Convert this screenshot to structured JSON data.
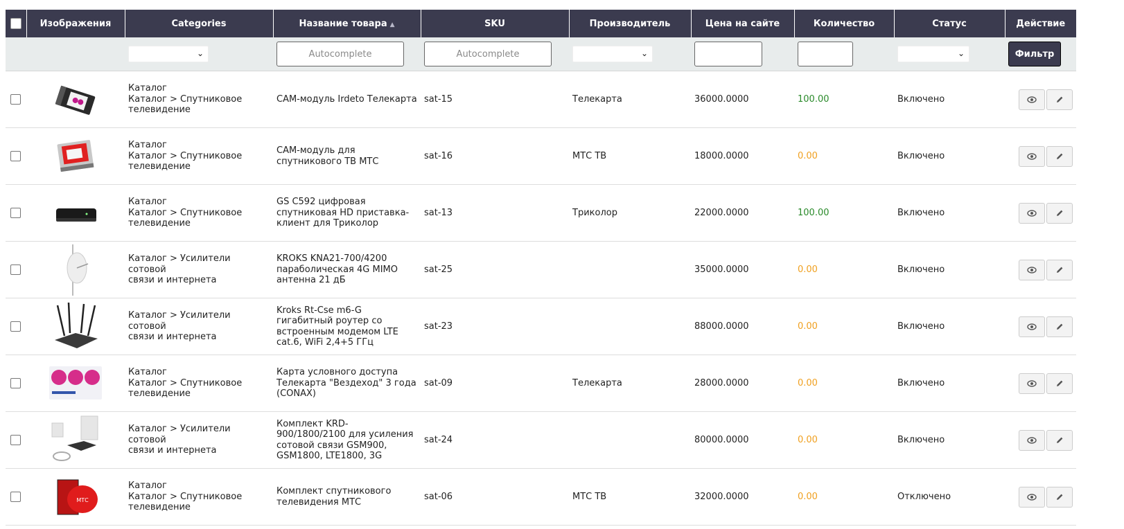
{
  "columns": {
    "images": "Изображения",
    "categories": "Categories",
    "name": "Название товара",
    "sku": "SKU",
    "manufacturer": "Производитель",
    "price": "Цена на сайте",
    "quantity": "Количество",
    "status": "Статус",
    "action": "Действие"
  },
  "filters": {
    "name_placeholder": "Autocomplete",
    "sku_placeholder": "Autocomplete",
    "button": "Фильтр"
  },
  "colors": {
    "header_bg": "#3b3b4f",
    "qty_positive": "#2a8a2a",
    "qty_zero": "#f0a020"
  },
  "rows": [
    {
      "image": "cam-module-irdeto-icon",
      "cat1": "Каталог",
      "cat2": "Каталог > Спутниковое",
      "cat3": "телевидение",
      "name": "CAM-модуль Irdeto Телекарта",
      "sku": "sat-15",
      "manufacturer": "Телекарта",
      "price": "36000.0000",
      "quantity": "100.00",
      "status": "Включено"
    },
    {
      "image": "cam-module-mts-icon",
      "cat1": "Каталог",
      "cat2": "Каталог > Спутниковое",
      "cat3": "телевидение",
      "name": "CAM-модуль для спутникового ТВ МТС",
      "sku": "sat-16",
      "manufacturer": "МТС ТВ",
      "price": "18000.0000",
      "quantity": "0.00",
      "status": "Включено"
    },
    {
      "image": "set-top-box-icon",
      "cat1": "Каталог",
      "cat2": "Каталог > Спутниковое",
      "cat3": "телевидение",
      "name": "GS C592 цифровая спутниковая HD приставка-клиент для Триколор",
      "sku": "sat-13",
      "manufacturer": "Триколор",
      "price": "22000.0000",
      "quantity": "100.00",
      "status": "Включено"
    },
    {
      "image": "antenna-icon",
      "cat1": "",
      "cat2": "Каталог > Усилители сотовой",
      "cat3": "связи и интернета",
      "name": "KROKS KNA21-700/4200 параболическая 4G MIMO антенна 21 дБ",
      "sku": "sat-25",
      "manufacturer": "",
      "price": "35000.0000",
      "quantity": "0.00",
      "status": "Включено"
    },
    {
      "image": "router-icon",
      "cat1": "",
      "cat2": "Каталог > Усилители сотовой",
      "cat3": "связи и интернета",
      "name": "Kroks Rt-Cse m6-G гигабитный роутер со встроенным модемом LTE cat.6, WiFi 2,4+5 ГГц",
      "sku": "sat-23",
      "manufacturer": "",
      "price": "88000.0000",
      "quantity": "0.00",
      "status": "Включено"
    },
    {
      "image": "access-card-icon",
      "cat1": "Каталог",
      "cat2": "Каталог > Спутниковое",
      "cat3": "телевидение",
      "name": "Карта условного доступа Телекарта \"Вездеход\" 3 года (CONAX)",
      "sku": "sat-09",
      "manufacturer": "Телекарта",
      "price": "28000.0000",
      "quantity": "0.00",
      "status": "Включено"
    },
    {
      "image": "repeater-kit-icon",
      "cat1": "",
      "cat2": "Каталог > Усилители сотовой",
      "cat3": "связи и интернета",
      "name": "Комплект KRD-900/1800/2100 для усиления сотовой связи GSM900, GSM1800, LTE1800, 3G",
      "sku": "sat-24",
      "manufacturer": "",
      "price": "80000.0000",
      "quantity": "0.00",
      "status": "Включено"
    },
    {
      "image": "satellite-kit-icon",
      "cat1": "Каталог",
      "cat2": "Каталог > Спутниковое",
      "cat3": "телевидение",
      "name": "Комплект спутникового телевидения МТС",
      "sku": "sat-06",
      "manufacturer": "МТС ТВ",
      "price": "32000.0000",
      "quantity": "0.00",
      "status": "Отключено"
    }
  ]
}
